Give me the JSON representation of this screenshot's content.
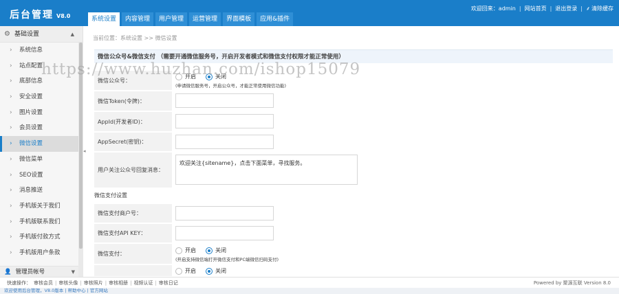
{
  "app": {
    "logo": "后台管理",
    "version": "V8.0"
  },
  "tabs": [
    "系统设置",
    "内容管理",
    "用户管理",
    "运营管理",
    "界面模板",
    "应用&插件"
  ],
  "top_right": {
    "welcome": "欢迎回来：admin",
    "site_home": "网站首页",
    "logout": "退出登录",
    "clear_cache": "清除缓存"
  },
  "sidebar": {
    "group_title": "基础设置",
    "items": [
      "系统信息",
      "站点配置",
      "底部信息",
      "安全设置",
      "图片设置",
      "会员设置",
      "微信设置",
      "微信菜单",
      "SEO设置",
      "消息推送",
      "手机版关于我们",
      "手机版联系我们",
      "手机版付款方式",
      "手机版用户条款"
    ],
    "active_item": "微信设置",
    "footer_group": "管理员帐号"
  },
  "breadcrumb": "当前位置：系统设置 >> 微信设置",
  "section_title": "微信公众号&微信支付 （需要开通微信服务号，开启开发者模式和微信支付权限才能正常使用）",
  "form": {
    "wechat_account": {
      "label": "微信公众号：",
      "on": "开启",
      "off": "关闭",
      "selected": "off",
      "hint": "(申请微信服务号，开启公众号，才能正常使用微信功能)"
    },
    "token": {
      "label": "微信Token(令牌)："
    },
    "appid": {
      "label": "AppId(开发者ID)："
    },
    "appsecret": {
      "label": "AppSecret(密钥)："
    },
    "reply": {
      "label": "用户关注公众号回复消息：",
      "value": "欢迎关注{sitename}，点击下面菜单，寻找服务。"
    },
    "pay_heading": "微信支付设置",
    "mch_id": {
      "label": "微信支付商户号："
    },
    "api_key": {
      "label": "微信支付API KEY："
    },
    "wechat_pay": {
      "label": "微信支付：",
      "on": "开启",
      "off": "关闭",
      "selected": "off",
      "hint": "(开启支持微信端打开微信支付和PC端微信扫码支付)"
    },
    "last_row": {
      "on": "开启",
      "off": "关闭",
      "selected": "off"
    }
  },
  "footer": {
    "quick_label": "快速操作：",
    "links": [
      "审核会员",
      "审核头像",
      "审核照片",
      "审核相册",
      "视频认证",
      "审核日记"
    ],
    "powered": "Powered by 聚源互联 Version 8.0"
  },
  "watermark": "https://www.huzhan.com/ishop15079",
  "status_bar": "欢迎使用后台管理，V8.0版本 | 帮助中心 | 官方网站",
  "colors": {
    "primary": "#1a7ec9",
    "label_bg": "#f2f2f2",
    "section_bg": "#eef4fb"
  }
}
